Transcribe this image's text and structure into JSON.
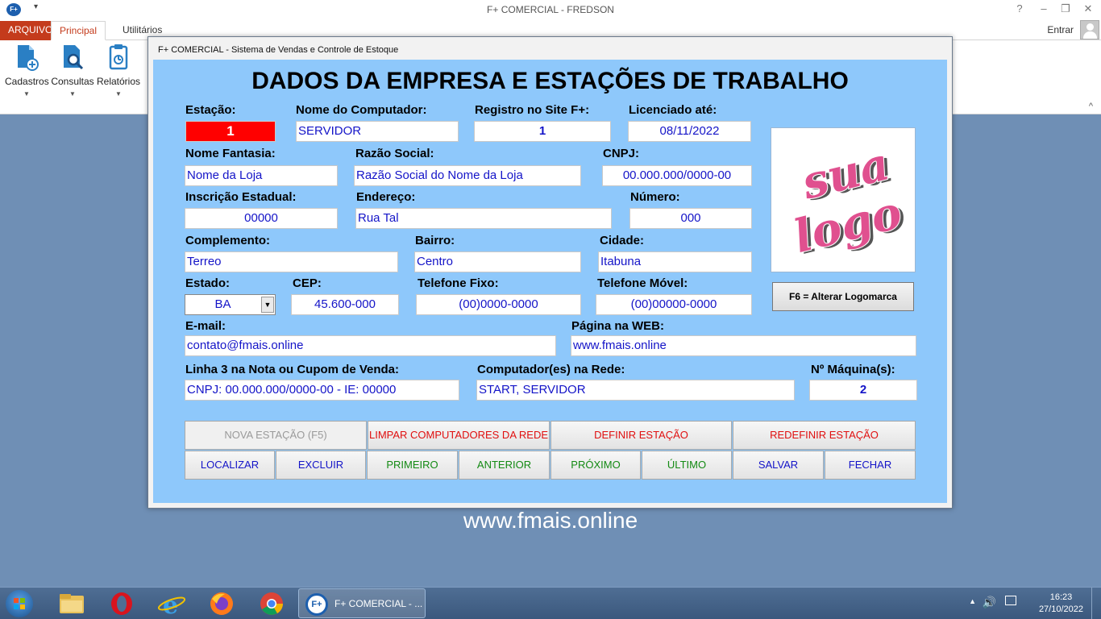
{
  "window": {
    "title": "F+ COMERCIAL - FREDSON",
    "controls": [
      "?",
      "–",
      "❐",
      "✕"
    ]
  },
  "ribbon": {
    "tabs": [
      "ARQUIVO",
      "Principal",
      "Utilitários"
    ],
    "user_label": "Entrar",
    "buttons": [
      {
        "label": "Cadastros",
        "icon": "cadastros-icon"
      },
      {
        "label": "Consultas",
        "icon": "consultas-icon"
      },
      {
        "label": "Relatórios",
        "icon": "relatorios-icon"
      }
    ]
  },
  "dialog": {
    "title": "F+ COMERCIAL - Sistema de Vendas e Controle de Estoque",
    "heading": "DADOS DA EMPRESA E ESTAÇÕES DE TRABALHO",
    "labels": {
      "estacao": "Estação:",
      "nome_computador": "Nome do Computador:",
      "registro": "Registro no Site F+:",
      "licenciado": "Licenciado até:",
      "nome_fantasia": "Nome Fantasia:",
      "razao_social": "Razão Social:",
      "cnpj": "CNPJ:",
      "inscricao": "Inscrição Estadual:",
      "endereco": "Endereço:",
      "numero": "Número:",
      "complemento": "Complemento:",
      "bairro": "Bairro:",
      "cidade": "Cidade:",
      "estado": "Estado:",
      "cep": "CEP:",
      "telefone_fixo": "Telefone Fixo:",
      "telefone_movel": "Telefone Móvel:",
      "email": "E-mail:",
      "pagina_web": "Página na WEB:",
      "linha3": "Linha 3 na Nota ou Cupom de Venda:",
      "computadores_rede": "Computador(es) na Rede:",
      "n_maquinas": "Nº Máquina(s):"
    },
    "values": {
      "estacao": "1",
      "nome_computador": "SERVIDOR",
      "registro": "1",
      "licenciado": "08/11/2022",
      "nome_fantasia": "Nome da Loja",
      "razao_social": "Razão Social do Nome da Loja",
      "cnpj": "00.000.000/0000-00",
      "inscricao": "00000",
      "endereco": "Rua Tal",
      "numero": "000",
      "complemento": "Terreo",
      "bairro": "Centro",
      "cidade": "Itabuna",
      "estado": "BA",
      "cep": "45.600-000",
      "telefone_fixo": "(00)0000-0000",
      "telefone_movel": "(00)00000-0000",
      "email": "contato@fmais.online",
      "pagina_web": "www.fmais.online",
      "linha3": "CNPJ: 00.000.000/0000-00 - IE: 00000",
      "computadores_rede": "START, SERVIDOR",
      "n_maquinas": "2"
    },
    "logo_text": [
      "sua",
      "logo"
    ],
    "logo_button": "F6 = Alterar Logomarca",
    "buttons_row1": [
      "NOVA ESTAÇÃO (F5)",
      "LIMPAR COMPUTADORES DA REDE",
      "DEFINIR ESTAÇÃO",
      "REDEFINIR ESTAÇÃO"
    ],
    "buttons_row2": [
      "LOCALIZAR",
      "EXCLUIR",
      "PRIMEIRO",
      "ANTERIOR",
      "PRÓXIMO",
      "ÚLTIMO",
      "SALVAR",
      "FECHAR"
    ]
  },
  "desktop": {
    "watermark": "www.fmais.online"
  },
  "taskbar": {
    "task_label": "F+ COMERCIAL - ...",
    "time": "16:23",
    "date": "27/10/2022"
  },
  "colors": {
    "dialog_bg": "#8ec8fb",
    "field_text": "#1414c8",
    "accent": "#c43b1c",
    "estacao_bg": "#ff0000"
  }
}
